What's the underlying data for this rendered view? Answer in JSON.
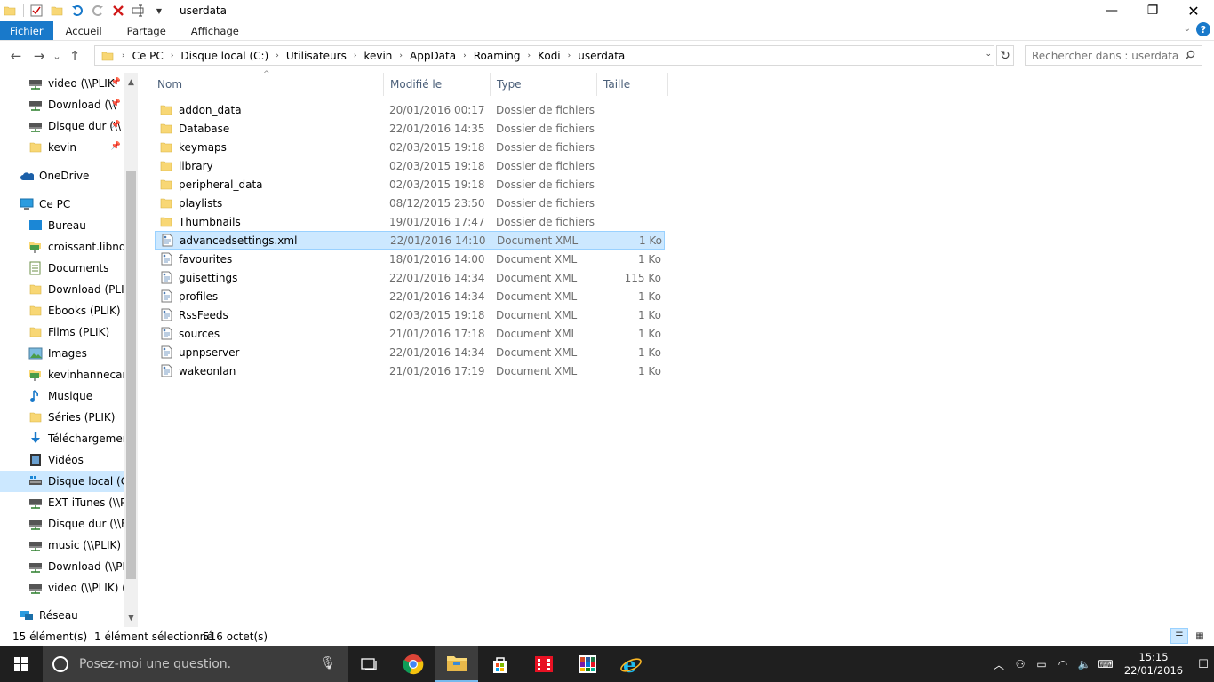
{
  "window": {
    "title": "userdata",
    "minimize": "—",
    "maximize": "❐",
    "close": "✕"
  },
  "ribbon": {
    "tabs": [
      {
        "label": "Fichier",
        "active": true
      },
      {
        "label": "Accueil"
      },
      {
        "label": "Partage"
      },
      {
        "label": "Affichage"
      }
    ],
    "help": "?"
  },
  "nav": {
    "back": "←",
    "forward": "→",
    "recent": "⌄",
    "up": "↑",
    "breadcrumb": [
      "Ce PC",
      "Disque local (C:)",
      "Utilisateurs",
      "kevin",
      "AppData",
      "Roaming",
      "Kodi",
      "userdata"
    ],
    "search_placeholder": "Rechercher dans : userdata"
  },
  "sidebar": {
    "items": [
      {
        "label": "video (\\\\PLIK",
        "icon": "network-drive-icon",
        "pinned": true
      },
      {
        "label": "Download (\\\\",
        "icon": "network-drive-icon",
        "pinned": true
      },
      {
        "label": "Disque dur (\\\\",
        "icon": "network-drive-icon",
        "pinned": true
      },
      {
        "label": "kevin",
        "icon": "folder-icon",
        "pinned": true
      },
      {
        "label": "OneDrive",
        "icon": "onedrive-icon"
      },
      {
        "label": "Ce PC",
        "icon": "computer-icon"
      },
      {
        "label": "Bureau",
        "icon": "desktop-icon"
      },
      {
        "label": "croissant.libndo",
        "icon": "network-folder-icon"
      },
      {
        "label": "Documents",
        "icon": "documents-icon"
      },
      {
        "label": "Download (PLIK)",
        "icon": "folder-icon"
      },
      {
        "label": "Ebooks (PLIK)",
        "icon": "folder-icon"
      },
      {
        "label": "Films (PLIK)",
        "icon": "folder-icon"
      },
      {
        "label": "Images",
        "icon": "images-icon"
      },
      {
        "label": "kevinhannecart.s",
        "icon": "network-folder-icon"
      },
      {
        "label": "Musique",
        "icon": "music-icon"
      },
      {
        "label": "Séries (PLIK)",
        "icon": "folder-icon"
      },
      {
        "label": "Téléchargement",
        "icon": "download-icon"
      },
      {
        "label": "Vidéos",
        "icon": "videos-icon"
      },
      {
        "label": "Disque local (C:)",
        "icon": "local-disk-icon",
        "selected": true
      },
      {
        "label": "EXT iTunes (\\\\PL",
        "icon": "network-drive-icon"
      },
      {
        "label": "Disque dur (\\\\FR",
        "icon": "network-drive-icon"
      },
      {
        "label": "music (\\\\PLIK) (",
        "icon": "network-drive-icon"
      },
      {
        "label": "Download (\\\\PLI",
        "icon": "network-drive-icon"
      },
      {
        "label": "video (\\\\PLIK) (Z",
        "icon": "network-drive-icon"
      },
      {
        "label": "Réseau",
        "icon": "network-icon"
      }
    ]
  },
  "columns": {
    "name": "Nom",
    "date": "Modifié le",
    "type": "Type",
    "size": "Taille"
  },
  "files": [
    {
      "name": "addon_data",
      "date": "20/01/2016 00:17",
      "type": "Dossier de fichiers",
      "size": "",
      "kind": "folder"
    },
    {
      "name": "Database",
      "date": "22/01/2016 14:35",
      "type": "Dossier de fichiers",
      "size": "",
      "kind": "folder"
    },
    {
      "name": "keymaps",
      "date": "02/03/2015 19:18",
      "type": "Dossier de fichiers",
      "size": "",
      "kind": "folder"
    },
    {
      "name": "library",
      "date": "02/03/2015 19:18",
      "type": "Dossier de fichiers",
      "size": "",
      "kind": "folder"
    },
    {
      "name": "peripheral_data",
      "date": "02/03/2015 19:18",
      "type": "Dossier de fichiers",
      "size": "",
      "kind": "folder"
    },
    {
      "name": "playlists",
      "date": "08/12/2015 23:50",
      "type": "Dossier de fichiers",
      "size": "",
      "kind": "folder"
    },
    {
      "name": "Thumbnails",
      "date": "19/01/2016 17:47",
      "type": "Dossier de fichiers",
      "size": "",
      "kind": "folder"
    },
    {
      "name": "advancedsettings.xml",
      "date": "22/01/2016 14:10",
      "type": "Document XML",
      "size": "1 Ko",
      "kind": "xml",
      "selected": true
    },
    {
      "name": "favourites",
      "date": "18/01/2016 14:00",
      "type": "Document XML",
      "size": "1 Ko",
      "kind": "xml"
    },
    {
      "name": "guisettings",
      "date": "22/01/2016 14:34",
      "type": "Document XML",
      "size": "115 Ko",
      "kind": "xml"
    },
    {
      "name": "profiles",
      "date": "22/01/2016 14:34",
      "type": "Document XML",
      "size": "1 Ko",
      "kind": "xml"
    },
    {
      "name": "RssFeeds",
      "date": "02/03/2015 19:18",
      "type": "Document XML",
      "size": "1 Ko",
      "kind": "xml"
    },
    {
      "name": "sources",
      "date": "21/01/2016 17:18",
      "type": "Document XML",
      "size": "1 Ko",
      "kind": "xml"
    },
    {
      "name": "upnpserver",
      "date": "22/01/2016 14:34",
      "type": "Document XML",
      "size": "1 Ko",
      "kind": "xml"
    },
    {
      "name": "wakeonlan",
      "date": "21/01/2016 17:19",
      "type": "Document XML",
      "size": "1 Ko",
      "kind": "xml"
    }
  ],
  "status": {
    "count": "15 élément(s)",
    "selected": "1 élément sélectionné",
    "size": "516 octet(s)"
  },
  "taskbar": {
    "search_placeholder": "Posez-moi une question.",
    "apps": [
      "task-view-icon",
      "chrome-icon",
      "file-explorer-icon",
      "store-icon",
      "media-app-icon",
      "office-icon",
      "internet-explorer-icon"
    ],
    "time": "15:15",
    "date": "22/01/2016"
  },
  "colors": {
    "accent": "#1979ca",
    "selection": "#cce8ff",
    "selection_border": "#99d1ff",
    "folder": "#f8d775",
    "taskbar": "#1f1f1f"
  }
}
